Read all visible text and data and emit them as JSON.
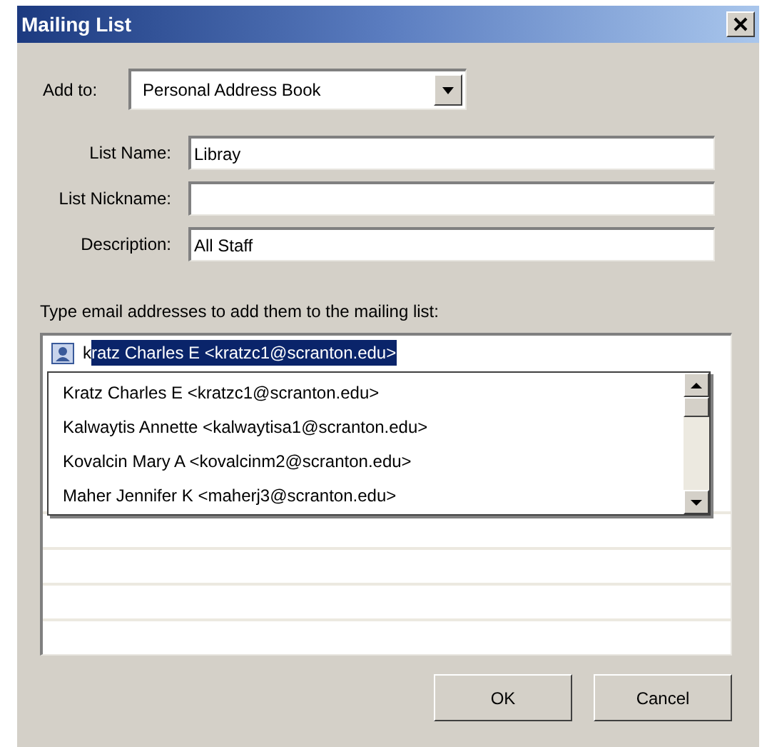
{
  "window": {
    "title": "Mailing List"
  },
  "add_to": {
    "label": "Add to:",
    "value": "Personal Address Book"
  },
  "fields": [
    {
      "label": "List Name:",
      "value": "Libray"
    },
    {
      "label": "List Nickname:"
    },
    {
      "label": "Description:",
      "value": "All Staff"
    }
  ],
  "instruction": "Type email addresses to add them to the mailing list:",
  "entry": {
    "typed": "k",
    "completion": "ratz Charles E <kratzc1@scranton.edu>"
  },
  "suggestions": [
    "Kratz Charles E <kratzc1@scranton.edu>",
    "Kalwaytis Annette <kalwaytisa1@scranton.edu>",
    "Kovalcin Mary A <kovalcinm2@scranton.edu>",
    "Maher Jennifer K <maherj3@scranton.edu>"
  ],
  "buttons": [
    "OK",
    "Cancel"
  ]
}
